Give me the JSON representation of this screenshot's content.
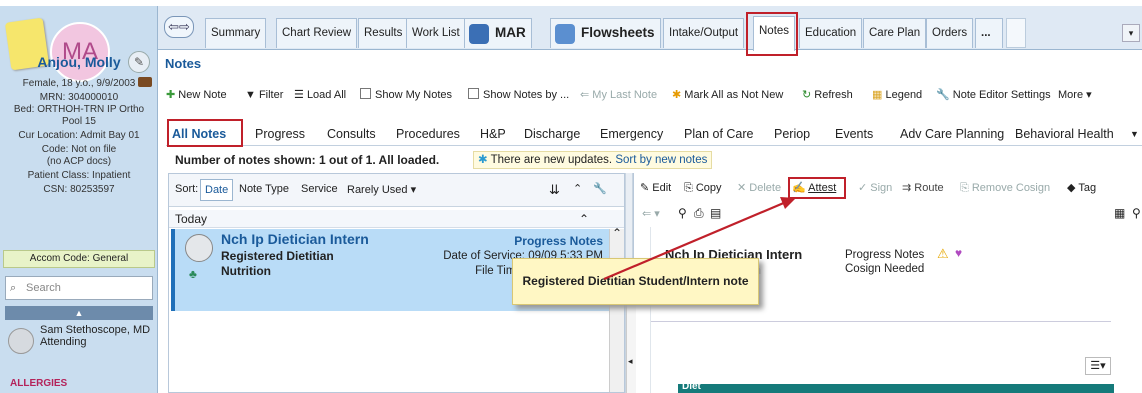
{
  "patient": {
    "initials": "MA",
    "name": "Anjou, Molly",
    "demographics": "Female, 18 y.o., 9/9/2003",
    "mrn": "MRN: 304000010",
    "bed": "Bed: ORTHOH-TRN IP Ortho",
    "pool": "Pool 15",
    "location": "Cur Location: Admit Bay 01",
    "code": "Code: Not on file",
    "code_sub": "(no ACP docs)",
    "patient_class": "Patient Class: Inpatient",
    "csn": "CSN: 80253597",
    "accom": "Accom Code: General",
    "search_placeholder": "Search",
    "provider_name": "Sam Stethoscope, MD",
    "provider_role": "Attending",
    "allergies": "ALLERGIES"
  },
  "tabs": [
    "Summary",
    "Chart Review",
    "Results",
    "Work List",
    "MAR",
    "Flowsheets",
    "Intake/Output",
    "Notes",
    "Education",
    "Care Plan",
    "Orders",
    "..."
  ],
  "notes": {
    "title": "Notes",
    "toolbar": {
      "new_note": "New Note",
      "filter": "Filter",
      "load_all": "Load All",
      "show_my_notes": "Show My Notes",
      "show_notes_by": "Show Notes by ...",
      "my_last_note": "My Last Note",
      "mark_all": "Mark All as Not New",
      "refresh": "Refresh",
      "legend": "Legend",
      "settings": "Note Editor Settings",
      "more": "More"
    },
    "filter_tabs": [
      "All Notes",
      "Progress",
      "Consults",
      "Procedures",
      "H&P",
      "Discharge",
      "Emergency",
      "Plan of Care",
      "Periop",
      "Events",
      "Adv Care Planning",
      "Behavioral Health"
    ],
    "summary": "Number of notes shown: 1 out of 1.  All loaded.",
    "updates_text": "There are new updates.",
    "updates_link": "Sort by new notes",
    "sort": {
      "label": "Sort:",
      "options": [
        "Date",
        "Note Type",
        "Service",
        "Rarely Used"
      ]
    },
    "group": "Today",
    "note": {
      "author": "Nch Ip Dietician Intern",
      "role": "Registered Dietitian",
      "service": "Nutrition",
      "type": "Progress Notes",
      "date_of_service": "Date of Service: 09/09 5:33 PM",
      "file_time": "File Time: 09/09 5:39 PM",
      "status": "Cosign Needed"
    },
    "detail_toolbar": [
      "Edit",
      "Copy",
      "Delete",
      "Attest",
      "Sign",
      "Route",
      "Remove Cosign",
      "Tag"
    ],
    "callout": "Registered Dietitian Student/Intern note",
    "section": "Diet"
  },
  "colors": {
    "accent": "#1a5a9a",
    "highlight": "#c0202a",
    "selected_row": "#b9dcf7"
  }
}
